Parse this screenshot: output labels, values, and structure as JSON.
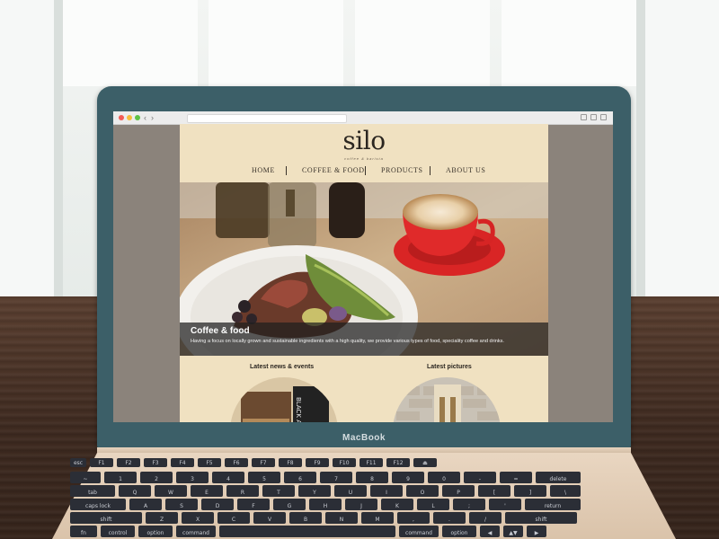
{
  "laptop": {
    "brand_label": "MacBook"
  },
  "browser": {
    "back_icon": "chevron-left-icon",
    "forward_icon": "chevron-right-icon"
  },
  "site": {
    "logo": "silo",
    "tagline": "coffee & barista",
    "nav": [
      {
        "label": "HOME"
      },
      {
        "label": "COFFEE & FOOD"
      },
      {
        "label": "PRODUCTS"
      },
      {
        "label": "ABOUT US"
      }
    ],
    "hero": {
      "title": "Coffee & food",
      "text": "Having a focus on locally grown and sustainable ingredients with a high quality, we provide various types of food, speciality coffee and drinks."
    },
    "sections": {
      "news_title": "Latest news & events",
      "pictures_title": "Latest pictures",
      "news_sign_text": "BLACK AEROPRESS COLD BREW FILTER COFFEE"
    }
  },
  "keyboard": {
    "row1": [
      "esc",
      "F1",
      "F2",
      "F3",
      "F4",
      "F5",
      "F6",
      "F7",
      "F8",
      "F9",
      "F10",
      "F11",
      "F12",
      "⏏"
    ],
    "row2": [
      "~",
      "1",
      "2",
      "3",
      "4",
      "5",
      "6",
      "7",
      "8",
      "9",
      "0",
      "-",
      "=",
      "delete"
    ],
    "row3": [
      "tab",
      "Q",
      "W",
      "E",
      "R",
      "T",
      "Y",
      "U",
      "I",
      "O",
      "P",
      "[",
      "]",
      "\\"
    ],
    "row4": [
      "caps lock",
      "A",
      "S",
      "D",
      "F",
      "G",
      "H",
      "J",
      "K",
      "L",
      ";",
      "'",
      "return"
    ],
    "row5": [
      "shift",
      "Z",
      "X",
      "C",
      "V",
      "B",
      "N",
      "M",
      ",",
      ".",
      "/",
      "shift"
    ],
    "row6": [
      "fn",
      "control",
      "option",
      "command",
      "",
      "command",
      "option",
      "◀",
      "▲▼",
      "▶"
    ]
  }
}
